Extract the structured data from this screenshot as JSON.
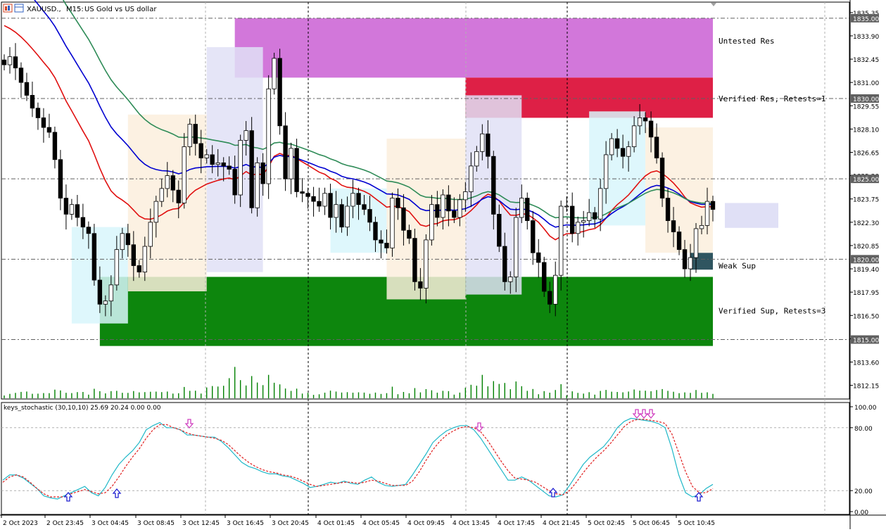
{
  "header": {
    "symbol": "XAUUSD.,",
    "timeframe": "M15:",
    "description": "US Gold vs US dollar"
  },
  "indicator": {
    "label": "keys_stochastic (30,10,10) 25.69 20.24 0.00 0.00"
  },
  "colors": {
    "bull_candle": "#000000",
    "volume": "#008000",
    "ma_fast": "#e01010",
    "ma_mid": "#0000d0",
    "ma_slow": "#2e8b57",
    "untested_res": "#d070d8",
    "verified_res": "#dc143c",
    "verified_sup": "#008000",
    "weak_sup": "#2f5560",
    "stoch_main": "#20b8c8",
    "stoch_signal": "#e02020",
    "arrow_up": "#2020d0",
    "arrow_down": "#d040c0"
  },
  "chart_data": [
    {
      "type": "candlestick",
      "price_axis": {
        "ylim": [
          1811.3,
          1836.0
        ],
        "tick_labels": [
          "1835.35",
          "1833.90",
          "1832.45",
          "1831.00",
          "1829.55",
          "1828.10",
          "1826.65",
          "1825.20",
          "1823.75",
          "1822.30",
          "1820.85",
          "1819.40",
          "1817.95",
          "1816.50",
          "1815.05",
          "1813.60",
          "1812.15"
        ],
        "highlight_labels": [
          "1835.00",
          "1830.00",
          "1825.00",
          "1820.00",
          "1815.00"
        ]
      },
      "time_axis": {
        "labels": [
          "2 Oct 2023",
          "2 Oct 23:45",
          "3 Oct 04:45",
          "3 Oct 08:45",
          "3 Oct 12:45",
          "3 Oct 16:45",
          "3 Oct 20:45",
          "4 Oct 01:45",
          "4 Oct 05:45",
          "4 Oct 09:45",
          "4 Oct 13:45",
          "4 Oct 17:45",
          "4 Oct 21:45",
          "5 Oct 02:45",
          "5 Oct 06:45",
          "5 Oct 10:45"
        ]
      },
      "zones": [
        {
          "label": "Untested Res",
          "from": 1831.3,
          "to": 1835.0
        },
        {
          "label": "Verified Res, Retests=1",
          "from": 1828.8,
          "to": 1831.3
        },
        {
          "label": "Verified Sup, Retests=3",
          "from": 1814.6,
          "to": 1818.9
        },
        {
          "label": "Weak Sup",
          "from": 1819.35,
          "to": 1820.4
        }
      ],
      "close_series": [
        1832.1,
        1832.6,
        1831.9,
        1831.0,
        1830.2,
        1829.4,
        1828.8,
        1828.2,
        1827.9,
        1826.2,
        1823.8,
        1822.8,
        1823.4,
        1822.6,
        1822.0,
        1821.6,
        1818.7,
        1817.2,
        1817.4,
        1818.4,
        1820.6,
        1821.6,
        1820.9,
        1819.6,
        1819.2,
        1820.8,
        1822.3,
        1823.6,
        1824.4,
        1825.2,
        1824.3,
        1823.5,
        1827.0,
        1828.4,
        1827.2,
        1826.3,
        1826.5,
        1825.9,
        1826.0,
        1825.8,
        1825.6,
        1824.0,
        1827.4,
        1828.0,
        1823.2,
        1826.0,
        1824.7,
        1830.6,
        1832.5,
        1828.3,
        1825.0,
        1826.9,
        1824.2,
        1824.1,
        1823.9,
        1823.6,
        1823.3,
        1824.1,
        1822.6,
        1823.4,
        1822.0,
        1823.3,
        1824.1,
        1823.4,
        1823.1,
        1822.3,
        1821.2,
        1821.0,
        1820.7,
        1823.8,
        1823.2,
        1821.8,
        1821.3,
        1818.6,
        1818.2,
        1821.2,
        1823.4,
        1822.6,
        1824.0,
        1823.0,
        1822.6,
        1823.7,
        1824.2,
        1825.8,
        1826.7,
        1827.8,
        1826.4,
        1822.8,
        1820.8,
        1818.6,
        1818.9,
        1822.6,
        1823.8,
        1822.4,
        1820.4,
        1819.8,
        1818.0,
        1817.2,
        1819.0,
        1823.3,
        1823.3,
        1821.6,
        1822.3,
        1822.4,
        1822.9,
        1822.5,
        1824.4,
        1826.5,
        1827.5,
        1826.9,
        1826.4,
        1827.0,
        1828.3,
        1828.8,
        1828.6,
        1827.6,
        1826.3,
        1823.8,
        1822.4,
        1821.7,
        1820.6,
        1819.4,
        1820.1,
        1821.9,
        1822.1,
        1823.6,
        1823.1
      ]
    },
    {
      "type": "line",
      "ylim": [
        0,
        100
      ],
      "tick_labels": [
        "100.00",
        "80.00",
        "20.00",
        "0.00"
      ],
      "series_values": [
        [
          30,
          35,
          35,
          32,
          27,
          22,
          15,
          13,
          12,
          15,
          18,
          21,
          24,
          18,
          15,
          23,
          35,
          45,
          52,
          58,
          66,
          78,
          82,
          85,
          80,
          80,
          78,
          73,
          73,
          72,
          71,
          71,
          67,
          61,
          54,
          47,
          43,
          41,
          38,
          36,
          36,
          34,
          33,
          30,
          27,
          23,
          24,
          26,
          28,
          27,
          29,
          27,
          26,
          30,
          33,
          28,
          25,
          24,
          25,
          26,
          35,
          45,
          55,
          66,
          72,
          77,
          80,
          82,
          82,
          78,
          70,
          60,
          50,
          40,
          30,
          30,
          33,
          30,
          25,
          20,
          15,
          14,
          16,
          25,
          35,
          45,
          52,
          57,
          62,
          70,
          80,
          86,
          89,
          88,
          87,
          86,
          84,
          80,
          60,
          35,
          18,
          14,
          16,
          22,
          26
        ],
        [
          28,
          33,
          35,
          33,
          28,
          22,
          17,
          14,
          14,
          14,
          17,
          19,
          21,
          19,
          17,
          18,
          24,
          33,
          43,
          52,
          60,
          70,
          78,
          83,
          83,
          80,
          78,
          75,
          73,
          72,
          71,
          70,
          68,
          64,
          58,
          52,
          47,
          43,
          40,
          38,
          37,
          35,
          34,
          32,
          29,
          26,
          24,
          25,
          26,
          27,
          28,
          28,
          27,
          28,
          30,
          29,
          27,
          25,
          25,
          25,
          29,
          38,
          49,
          59,
          67,
          73,
          77,
          80,
          81,
          80,
          76,
          68,
          58,
          48,
          39,
          32,
          31,
          30,
          28,
          24,
          20,
          17,
          16,
          20,
          28,
          37,
          45,
          52,
          58,
          65,
          73,
          81,
          86,
          88,
          88,
          87,
          86,
          84,
          74,
          56,
          38,
          24,
          18,
          18,
          22
        ]
      ]
    }
  ]
}
